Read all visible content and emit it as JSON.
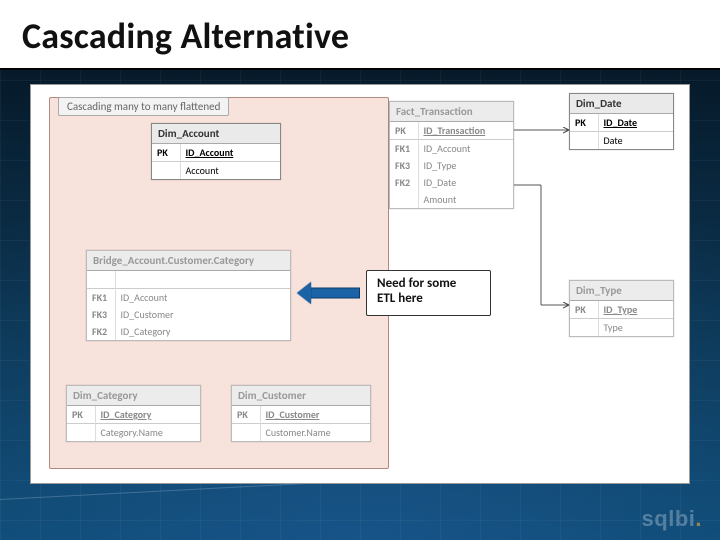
{
  "slide": {
    "title": "Cascading Alternative",
    "group_label": "Cascading many to many flattened",
    "callout": {
      "line1": "Need for some",
      "line2": "ETL here"
    },
    "logo": {
      "text": "sqlbi",
      "accent": "."
    }
  },
  "entities": {
    "dim_account": {
      "title": "Dim_Account",
      "rows": [
        {
          "k": "PK",
          "v": "ID_Account",
          "pk": true
        },
        {
          "k": "",
          "v": "Account",
          "sep": true
        }
      ]
    },
    "bridge": {
      "title": "Bridge_Account.Customer.Category",
      "rows": [
        {
          "k": "",
          "v": ""
        },
        {
          "k": "FK1",
          "v": "ID_Account",
          "sep": true
        },
        {
          "k": "FK3",
          "v": "ID_Customer"
        },
        {
          "k": "FK2",
          "v": "ID_Category"
        }
      ]
    },
    "dim_category": {
      "title": "Dim_Category",
      "rows": [
        {
          "k": "PK",
          "v": "ID_Category",
          "pk": true
        },
        {
          "k": "",
          "v": "Category.Name",
          "sep": true
        }
      ]
    },
    "dim_customer": {
      "title": "Dim_Customer",
      "rows": [
        {
          "k": "PK",
          "v": "ID_Customer",
          "pk": true
        },
        {
          "k": "",
          "v": "Customer.Name",
          "sep": true
        }
      ]
    },
    "fact_transaction": {
      "title": "Fact_Transaction",
      "rows": [
        {
          "k": "PK",
          "v": "ID_Transaction",
          "pk": true
        },
        {
          "k": "FK1",
          "v": "ID_Account",
          "sep": true
        },
        {
          "k": "FK3",
          "v": "ID_Type"
        },
        {
          "k": "FK2",
          "v": "ID_Date"
        },
        {
          "k": "",
          "v": "Amount"
        }
      ]
    },
    "dim_date": {
      "title": "Dim_Date",
      "rows": [
        {
          "k": "PK",
          "v": "ID_Date",
          "pk": true
        },
        {
          "k": "",
          "v": "Date",
          "sep": true
        }
      ]
    },
    "dim_type": {
      "title": "Dim_Type",
      "rows": [
        {
          "k": "PK",
          "v": "ID_Type",
          "pk": true
        },
        {
          "k": "",
          "v": "Type",
          "sep": true
        }
      ]
    }
  }
}
